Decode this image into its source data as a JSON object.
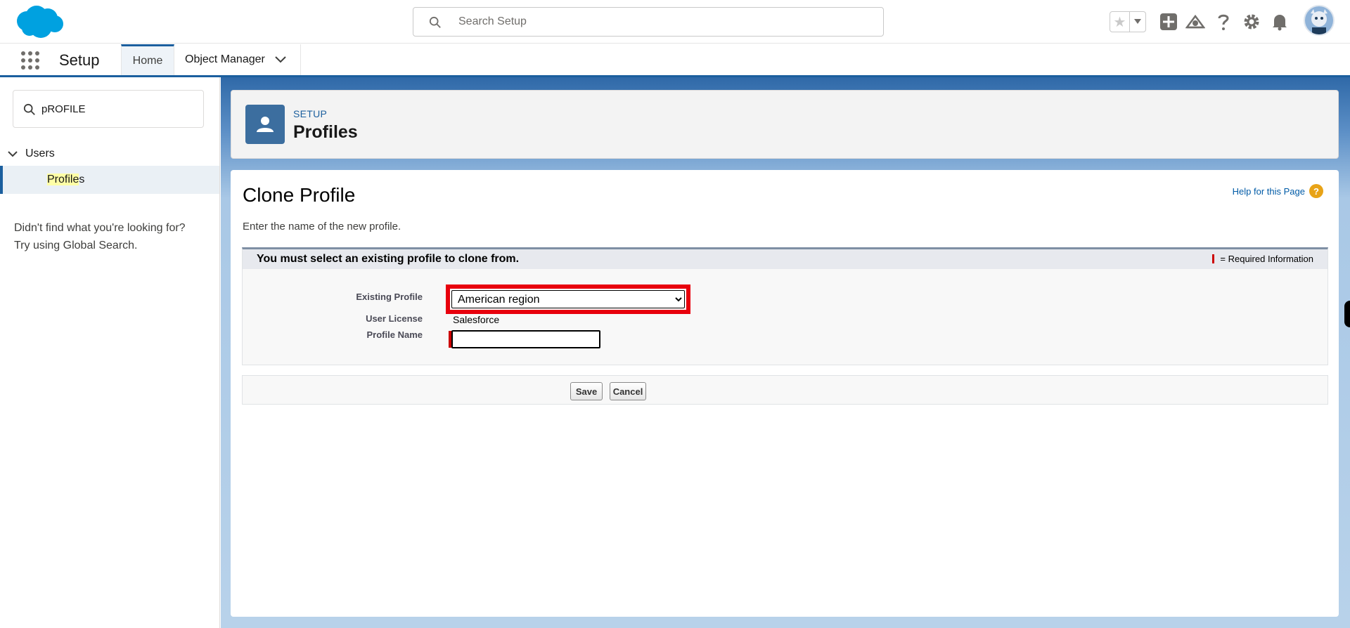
{
  "header": {
    "search_placeholder": "Search Setup",
    "icons": [
      "favorites-star-icon",
      "favorites-dropdown-icon",
      "global-actions-plus-icon",
      "trailhead-icon",
      "help-icon",
      "setup-gear-icon",
      "notifications-bell-icon",
      "user-avatar"
    ]
  },
  "context_bar": {
    "app_name": "Setup",
    "tabs": [
      {
        "label": "Home"
      },
      {
        "label": "Object Manager"
      }
    ]
  },
  "sidebar": {
    "quick_find_value": "pROFILE",
    "tree": {
      "section": "Users",
      "item_highlight": "Profile",
      "item_rest": "s"
    },
    "help_line1": "Didn't find what you're looking for?",
    "help_line2": "Try using Global Search."
  },
  "page_header": {
    "eyebrow": "SETUP",
    "title": "Profiles"
  },
  "content": {
    "title": "Clone Profile",
    "help_link": "Help for this Page",
    "description": "Enter the name of the new profile.",
    "section_title": "You must select an existing profile to clone from.",
    "required_info": "= Required Information",
    "fields": {
      "existing_profile_label": "Existing Profile",
      "existing_profile_value": "American region",
      "user_license_label": "User License",
      "user_license_value": "Salesforce",
      "profile_name_label": "Profile Name",
      "profile_name_value": ""
    },
    "buttons": {
      "save": "Save",
      "cancel": "Cancel"
    }
  },
  "colors": {
    "brand_blue": "#1b5f9e",
    "salesforce_cloud": "#00a1e0",
    "highlight_red": "#e8000d",
    "required_red": "#cc0000"
  }
}
